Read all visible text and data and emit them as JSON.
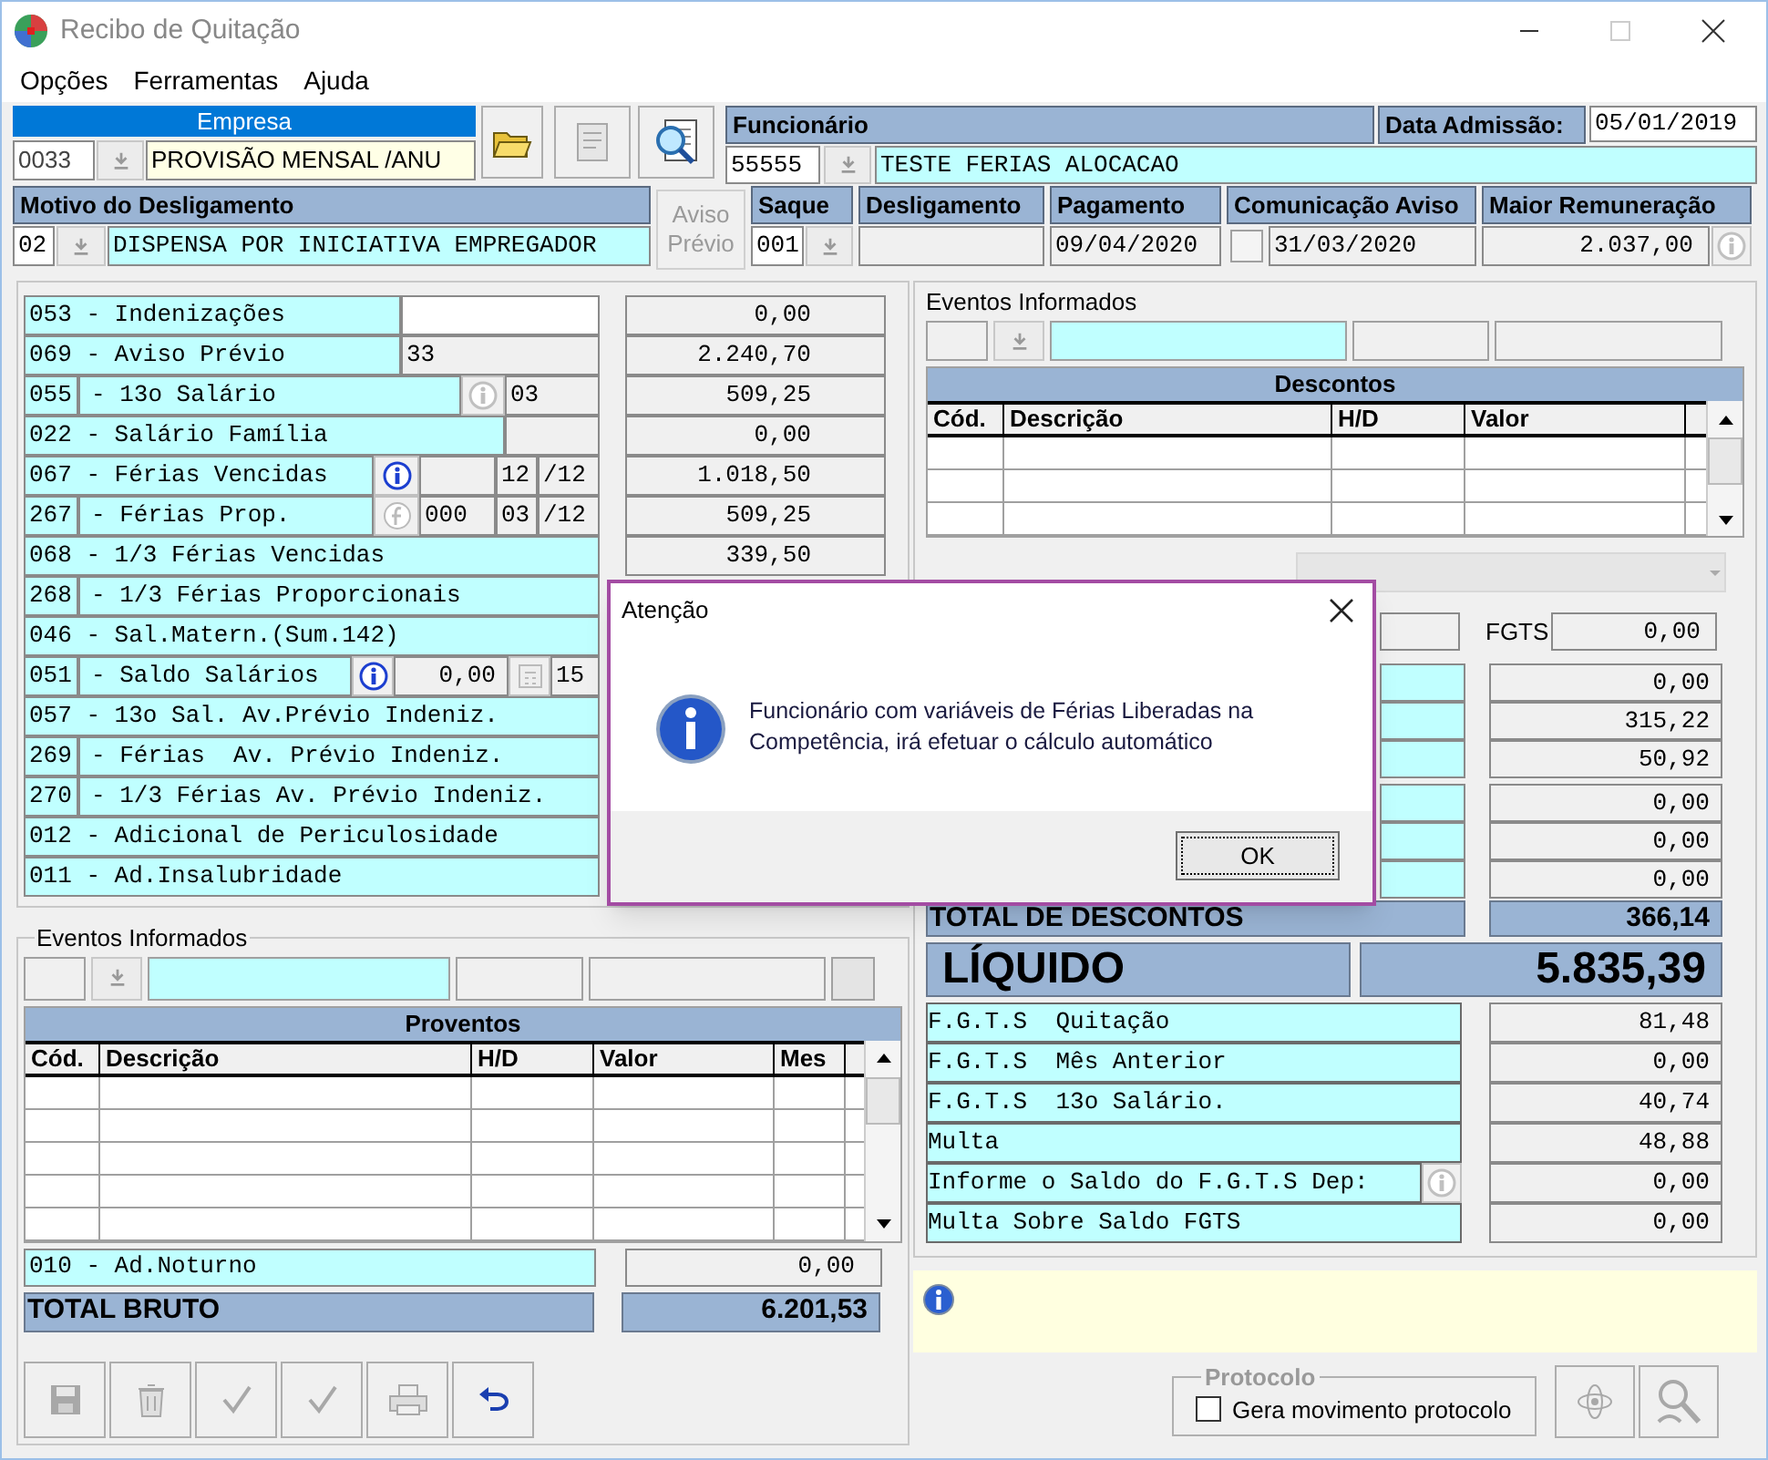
{
  "window": {
    "title": "Recibo de Quitação"
  },
  "menu": [
    "Opções",
    "Ferramentas",
    "Ajuda"
  ],
  "empresa": {
    "label": "Empresa",
    "code": "0033",
    "name": "PROVISÃO MENSAL /ANU"
  },
  "top_buttons": [
    {
      "kind": "open_folder",
      "disabled": false
    },
    {
      "kind": "report",
      "disabled": true
    },
    {
      "kind": "preview",
      "disabled": false
    }
  ],
  "funcionario": {
    "label": "Funcionário",
    "code": "55555",
    "name": "TESTE FERIAS ALOCACAO"
  },
  "data_admissao": {
    "label": "Data Admissão:",
    "value": "05/01/2019"
  },
  "motivo": {
    "label": "Motivo do Desligamento",
    "code": "02",
    "description": "DISPENSA POR INICIATIVA EMPREGADOR"
  },
  "aviso_previo_button": {
    "label": "Aviso Prévio",
    "disabled": true
  },
  "saque": {
    "label": "Saque",
    "code": "001"
  },
  "desligamento": {
    "label": "Desligamento"
  },
  "pagamento": {
    "label": "Pagamento",
    "value": "09/04/2020"
  },
  "comunicacao_aviso": {
    "label": "Comunicação Aviso",
    "checked": false,
    "value": "31/03/2020"
  },
  "maior_remuneracao": {
    "label": "Maior Remuneração",
    "value": "2.037,00"
  },
  "proventos_items": [
    {
      "label": "053 - Indenizações",
      "extras": [
        {
          "kind": "input"
        }
      ],
      "value": "0,00"
    },
    {
      "label": "069 - Aviso Prévio",
      "extras": [
        {
          "kind": "field",
          "text": "33"
        }
      ],
      "value": "2.240,70"
    },
    {
      "code": "055",
      "label": "- 13o Salário",
      "extras": [
        {
          "kind": "info",
          "disabled": true
        },
        {
          "kind": "field",
          "text": "03"
        }
      ],
      "value": "509,25"
    },
    {
      "label": "022 - Salário Família",
      "extras": [
        {
          "kind": "field"
        }
      ],
      "value": "0,00"
    },
    {
      "label": "067 - Férias Vencidas",
      "extras": [
        {
          "kind": "info",
          "disabled": false
        },
        {
          "kind": "field"
        },
        {
          "kind": "field",
          "text": "12"
        },
        {
          "kind": "field",
          "text": "/12"
        }
      ],
      "value": "1.018,50"
    },
    {
      "code": "267",
      "label": "- Férias Prop.",
      "extras": [
        {
          "kind": "formula",
          "disabled": true
        },
        {
          "kind": "field",
          "text": "000"
        },
        {
          "kind": "field",
          "text": "03"
        },
        {
          "kind": "field",
          "text": "/12"
        }
      ],
      "value": "509,25"
    },
    {
      "label": "068 - 1/3 Férias Vencidas",
      "value": "339,50"
    },
    {
      "code": "268",
      "label": "- 1/3 Férias Proporcionais"
    },
    {
      "label": "046 - Sal.Matern.(Sum.142)"
    },
    {
      "code": "051",
      "label": "- Saldo Salários",
      "extras": [
        {
          "kind": "info",
          "disabled": false
        },
        {
          "kind": "amount",
          "text": "0,00"
        },
        {
          "kind": "tool",
          "disabled": true
        },
        {
          "kind": "field",
          "text": "15"
        }
      ]
    },
    {
      "label": "057 - 13o Sal. Av.Prévio Indeniz."
    },
    {
      "code": "269",
      "label": "- Férias  Av. Prévio Indeniz."
    },
    {
      "code": "270",
      "label": "- 1/3 Férias Av. Prévio Indeniz."
    },
    {
      "label": "012 - Adicional de Periculosidade"
    },
    {
      "label": "011 - Ad.Insalubridade"
    }
  ],
  "eventos_proventos": {
    "label": "Eventos Informados",
    "table": {
      "title": "Proventos",
      "columns": [
        "Cód.",
        "Descrição",
        "H/D",
        "Valor",
        "Mes"
      ]
    }
  },
  "adicional_noturno": {
    "label": "010 - Ad.Noturno",
    "value": "0,00"
  },
  "total_bruto": {
    "label": "TOTAL BRUTO",
    "value": "6.201,53"
  },
  "toolbar": [
    {
      "kind": "save",
      "disabled": true
    },
    {
      "kind": "recycle",
      "disabled": true
    },
    {
      "kind": "check",
      "disabled": true
    },
    {
      "kind": "check",
      "disabled": true
    },
    {
      "kind": "print",
      "disabled": true
    },
    {
      "kind": "undo",
      "disabled": false
    }
  ],
  "eventos_descontos": {
    "label": "Eventos Informados",
    "table": {
      "title": "Descontos",
      "columns": [
        "Cód.",
        "Descrição",
        "H/D",
        "Valor"
      ]
    }
  },
  "fgts_field": {
    "label": "FGTS",
    "value": "0,00"
  },
  "desconto_values": [
    "0,00",
    "315,22",
    "50,92",
    "0,00",
    "0,00",
    "0,00"
  ],
  "total_descontos": {
    "label": "TOTAL DE DESCONTOS",
    "value": "366,14"
  },
  "liquido": {
    "label": "LÍQUIDO",
    "value": "5.835,39"
  },
  "fgts_rows": [
    {
      "label": "F.G.T.S  Quitação",
      "value": "81,48"
    },
    {
      "label": "F.G.T.S  Mês Anterior",
      "value": "0,00"
    },
    {
      "label": "F.G.T.S  13o Salário.",
      "value": "40,74"
    },
    {
      "label": "Multa",
      "value": "48,88"
    },
    {
      "label": "Informe o Saldo do F.G.T.S Dep:",
      "value": "0,00",
      "info": true
    },
    {
      "label": "Multa Sobre Saldo FGTS",
      "value": "0,00"
    }
  ],
  "protocolo": {
    "label": "Protocolo",
    "checkbox": {
      "label": "Gera movimento protocolo",
      "checked": false
    }
  },
  "bottom_buttons": [
    {
      "kind": "atom",
      "disabled": true
    },
    {
      "kind": "search_person",
      "disabled": true
    }
  ],
  "dialog": {
    "title": "Atenção",
    "message": "Funcionário com variáveis de Férias Liberadas na Competência, irá efetuar o cálculo automático",
    "button": "OK"
  }
}
